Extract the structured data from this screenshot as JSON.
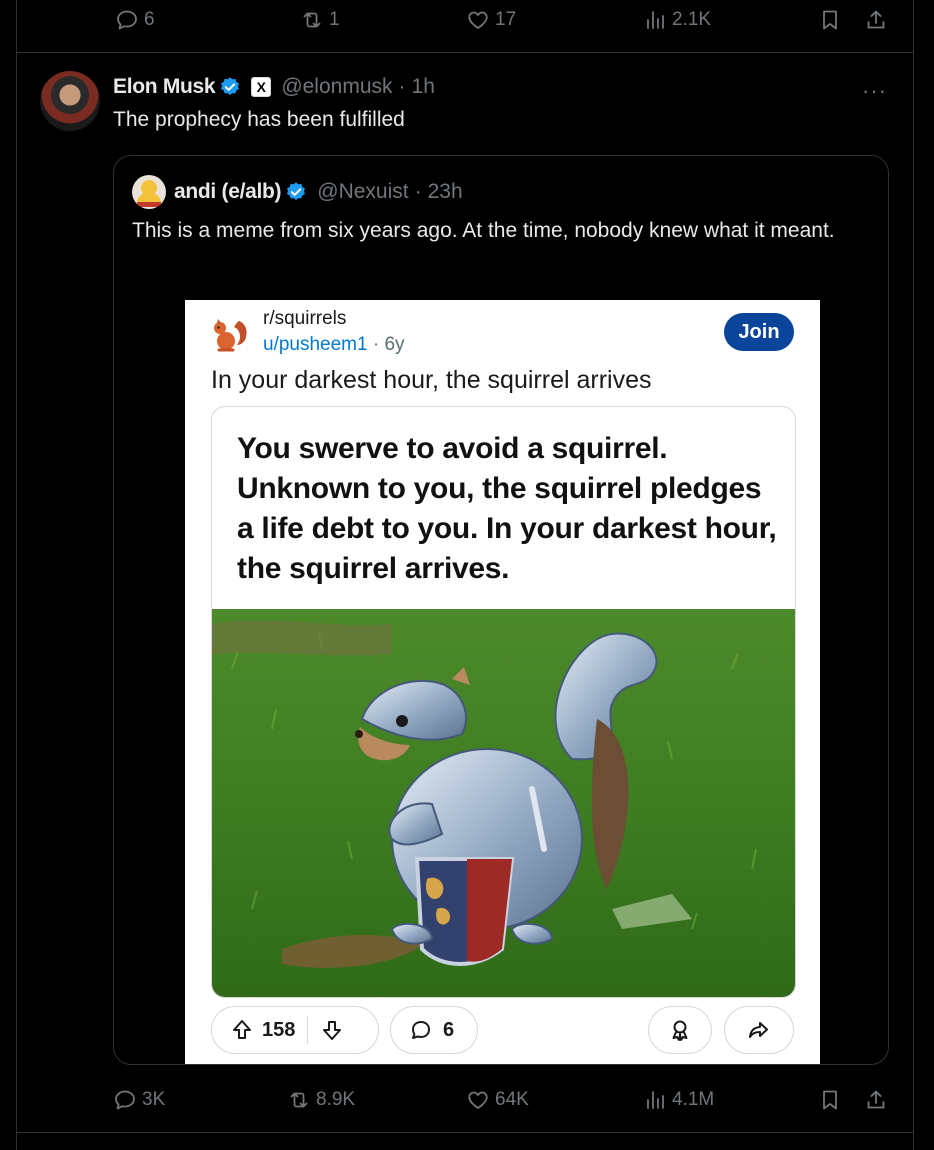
{
  "top_actions": {
    "replies": "6",
    "reposts": "1",
    "likes": "17",
    "views": "2.1K"
  },
  "tweet": {
    "author_name": "Elon Musk",
    "affiliate_badge": "X",
    "handle": "@elonmusk",
    "separator": "·",
    "time": "1h",
    "text": "The prophecy has been fulfilled",
    "more": "···"
  },
  "quoted": {
    "author_name": "andi (e/alb)",
    "handle": "@Nexuist",
    "separator": "·",
    "time": "23h",
    "text": "This is a meme from six years ago. At the time, nobody knew what it meant."
  },
  "reddit": {
    "subreddit": "r/squirrels",
    "user": "u/pusheem1",
    "dot": "·",
    "age": "6y",
    "join_label": "Join",
    "title": "In your darkest hour, the squirrel arrives",
    "meme_text": "You swerve to avoid a squirrel. Unknown to you, the squirrel pledges a life debt to you. In your darkest hour, the squirrel arrives.",
    "upvotes": "158",
    "comments": "6"
  },
  "bottom_actions": {
    "replies": "3K",
    "reposts": "8.9K",
    "likes": "64K",
    "views": "4.1M"
  },
  "colors": {
    "background": "#000000",
    "border": "#2f3336",
    "muted": "#71767b",
    "verified": "#1d9bf0",
    "reddit_join": "#0a449b",
    "reddit_link": "#0079d3"
  }
}
